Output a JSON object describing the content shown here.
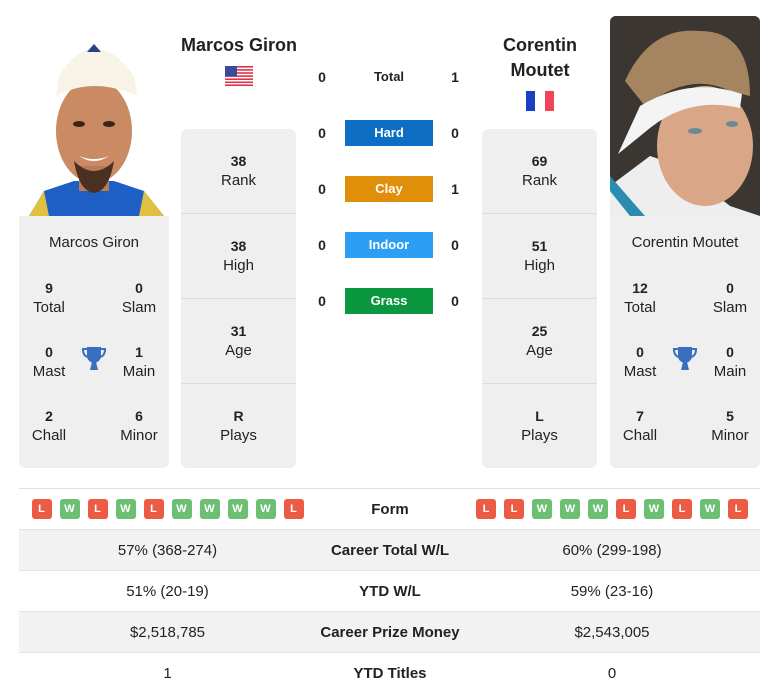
{
  "colors": {
    "hard": "#0d6ec4",
    "clay": "#df8f0a",
    "indoor": "#2c9ef3",
    "grass": "#0b9640",
    "win": "#6dbf73",
    "loss": "#ee5b45",
    "trophy": "#3a6fbf"
  },
  "player1": {
    "name": "Marcos Giron",
    "flag": "us-flag",
    "photo": "player-photo",
    "info": [
      {
        "value": "38",
        "label": "Rank"
      },
      {
        "value": "38",
        "label": "High"
      },
      {
        "value": "31",
        "label": "Age"
      },
      {
        "value": "R",
        "label": "Plays"
      }
    ],
    "titles": {
      "name": "Marcos Giron",
      "total": {
        "value": "9",
        "label": "Total"
      },
      "slam": {
        "value": "0",
        "label": "Slam"
      },
      "mast": {
        "value": "0",
        "label": "Mast"
      },
      "main": {
        "value": "1",
        "label": "Main"
      },
      "chall": {
        "value": "2",
        "label": "Chall"
      },
      "minor": {
        "value": "6",
        "label": "Minor"
      }
    },
    "form": [
      "L",
      "W",
      "L",
      "W",
      "L",
      "W",
      "W",
      "W",
      "W",
      "L"
    ],
    "career_wl": "57% (368-274)",
    "ytd_wl": "51% (20-19)",
    "prize": "$2,518,785",
    "ytd_titles": "1"
  },
  "player2": {
    "name": "Corentin Moutet",
    "flag": "fr-flag",
    "photo": "player-photo",
    "info": [
      {
        "value": "69",
        "label": "Rank"
      },
      {
        "value": "51",
        "label": "High"
      },
      {
        "value": "25",
        "label": "Age"
      },
      {
        "value": "L",
        "label": "Plays"
      }
    ],
    "titles": {
      "name": "Corentin Moutet",
      "total": {
        "value": "12",
        "label": "Total"
      },
      "slam": {
        "value": "0",
        "label": "Slam"
      },
      "mast": {
        "value": "0",
        "label": "Mast"
      },
      "main": {
        "value": "0",
        "label": "Main"
      },
      "chall": {
        "value": "7",
        "label": "Chall"
      },
      "minor": {
        "value": "5",
        "label": "Minor"
      }
    },
    "form": [
      "L",
      "L",
      "W",
      "W",
      "W",
      "L",
      "W",
      "L",
      "W",
      "L"
    ],
    "career_wl": "60% (299-198)",
    "ytd_wl": "59% (23-16)",
    "prize": "$2,543,005",
    "ytd_titles": "0"
  },
  "h2h": [
    {
      "label": "Total",
      "p1": "0",
      "p2": "1"
    },
    {
      "label": "Hard",
      "p1": "0",
      "p2": "0"
    },
    {
      "label": "Clay",
      "p1": "0",
      "p2": "1"
    },
    {
      "label": "Indoor",
      "p1": "0",
      "p2": "0"
    },
    {
      "label": "Grass",
      "p1": "0",
      "p2": "0"
    }
  ],
  "table_labels": {
    "form": "Form",
    "career_wl": "Career Total W/L",
    "ytd_wl": "YTD W/L",
    "prize": "Career Prize Money",
    "ytd_titles": "YTD Titles"
  }
}
